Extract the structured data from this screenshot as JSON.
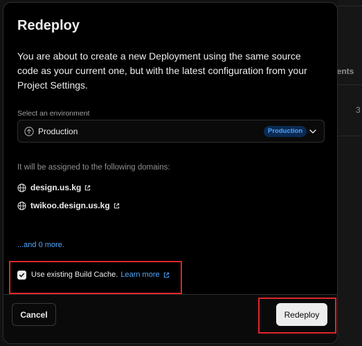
{
  "background": {
    "col_header": "ments",
    "row_value": "3"
  },
  "modal": {
    "title": "Redeploy",
    "description": "You are about to create a new Deployment using the same source code as your current one, but with the latest configuration from your Project Settings.",
    "environment": {
      "label": "Select an environment",
      "value": "Production",
      "badge": "Production"
    },
    "domains": {
      "label": "It will be assigned to the following domains:",
      "items": [
        "design.us.kg",
        "twikoo.design.us.kg"
      ],
      "more": "...and 0 more."
    },
    "cache": {
      "label": "Use existing Build Cache.",
      "checked": true,
      "learn_more": "Learn more"
    },
    "footer": {
      "cancel_label": "Cancel",
      "redeploy_label": "Redeploy"
    }
  },
  "colors": {
    "accent_link": "#52a8ff",
    "badge_bg": "#0b2a52",
    "highlight": "#e0262b"
  },
  "icons": {
    "environment": "arrow-up-circle-icon",
    "select": "chevron-down-icon",
    "domain": "globe-icon",
    "external": "external-link-icon",
    "check": "checkmark-icon"
  }
}
